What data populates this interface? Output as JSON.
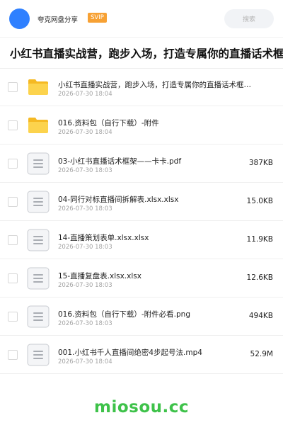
{
  "header": {
    "account_name": "夸克网盘分享",
    "badge": "SVIP",
    "search_label": "搜索"
  },
  "folder": {
    "title": "小红书直播实战营，跑步入场，打造专属你的直播话术框架"
  },
  "files": [
    {
      "name": "小红书直播实战营，跑步入场，打造专属你的直播话术框…",
      "date": "2026-07-30 18:04",
      "size": "",
      "type": "folder"
    },
    {
      "name": "016.资料包（自行下载）-附件",
      "date": "2026-07-30 18:04",
      "size": "",
      "type": "folder"
    },
    {
      "name": "03-小红书直播话术框架——卡卡.pdf",
      "date": "2026-07-30 18:03",
      "size": "387KB",
      "type": "file"
    },
    {
      "name": "04-同行对标直播间拆解表.xlsx.xlsx",
      "date": "2026-07-30 18:03",
      "size": "15.0KB",
      "type": "file"
    },
    {
      "name": "14-直播策划表单.xlsx.xlsx",
      "date": "2026-07-30 18:03",
      "size": "11.9KB",
      "type": "file"
    },
    {
      "name": "15-直播复盘表.xlsx.xlsx",
      "date": "2026-07-30 18:03",
      "size": "12.6KB",
      "type": "file"
    },
    {
      "name": "016.资料包（自行下载）-附件必看.png",
      "date": "2026-07-30 18:03",
      "size": "494KB",
      "type": "file"
    },
    {
      "name": "001.小红书千人直播间绝密4步起号法.mp4",
      "date": "2026-07-30 18:04",
      "size": "52.9M",
      "type": "file"
    }
  ],
  "footer": {
    "watermark": "miosou.cc"
  },
  "colors": {
    "avatar": "#2f80ff",
    "svip_badge": "#f7a134",
    "folder_icon": "#fcd34d",
    "watermark": "#3ec24a"
  },
  "icons": {
    "folder": "folder-icon",
    "file": "document-icon"
  }
}
